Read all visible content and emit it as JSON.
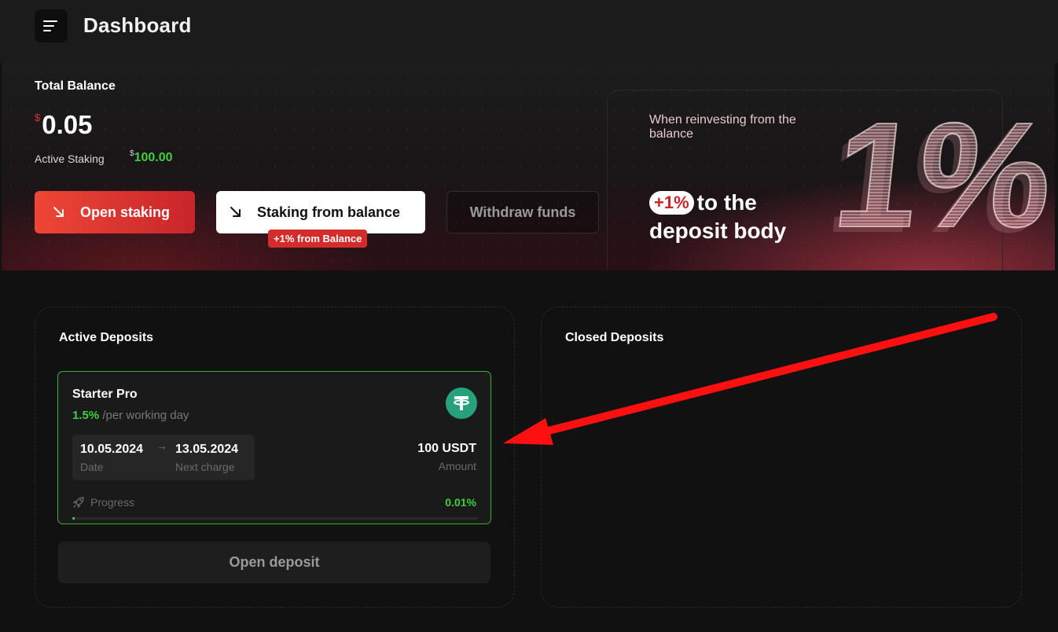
{
  "header": {
    "title": "Dashboard"
  },
  "balance": {
    "label": "Total Balance",
    "currency_symbol": "$",
    "value": "0.05",
    "active_staking_label": "Active Staking",
    "active_staking_value": "100.00"
  },
  "actions": {
    "open_staking": "Open staking",
    "staking_from_balance": "Staking from balance",
    "staking_badge": "+1% from Balance",
    "withdraw": "Withdraw funds"
  },
  "promo": {
    "subtitle": "When reinvesting from the balance",
    "chip": "+1%",
    "line1": "to the",
    "line2": "deposit body",
    "big_text": "1%"
  },
  "active_deposits": {
    "title": "Active Deposits",
    "cards": [
      {
        "name": "Starter Pro",
        "rate": "1.5%",
        "rate_suffix": "/per working day",
        "date": "10.05.2024",
        "date_label": "Date",
        "next_charge": "13.05.2024",
        "next_charge_label": "Next charge",
        "amount": "100 USDT",
        "amount_label": "Amount",
        "progress_label": "Progress",
        "progress_value": "0.01%",
        "progress_fraction": 0.0001
      }
    ],
    "open_deposit": "Open deposit"
  },
  "closed_deposits": {
    "title": "Closed Deposits"
  },
  "colors": {
    "accent_red": "#e0332e",
    "success_green": "#3fcf3f",
    "tether_green": "#26a17b",
    "annotation_red": "#ff1010"
  },
  "icons": {
    "menu": "menu-icon",
    "arrow": "arrow-down-right-icon",
    "tether": "tether-icon",
    "progress": "rocket-icon"
  }
}
